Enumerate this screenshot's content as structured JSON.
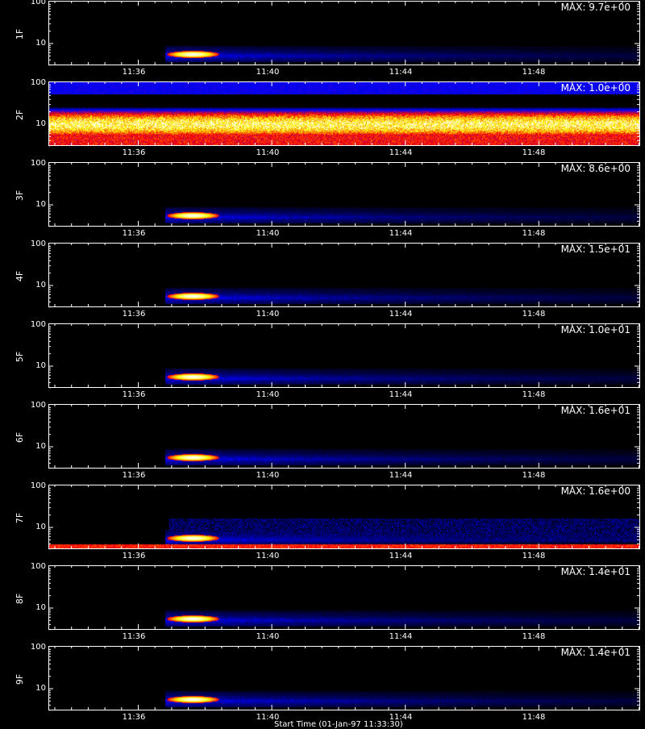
{
  "chart_data": {
    "type": "heatmap",
    "x_tick_labels": [
      "11:36",
      "11:40",
      "11:44",
      "11:48"
    ],
    "y_tick_labels": [
      "10",
      "100"
    ],
    "y_scale": "log",
    "colormap": [
      "#000000",
      "#0000ff",
      "#ff0000",
      "#ffff00",
      "#ffffff"
    ],
    "panels": [
      {
        "label": "1F",
        "max_text": "MAX: 9.7e+00",
        "pattern": "burst"
      },
      {
        "label": "2F",
        "max_text": "MAX: 1.0e+00",
        "pattern": "noise_band"
      },
      {
        "label": "3F",
        "max_text": "MAX: 8.6e+00",
        "pattern": "burst"
      },
      {
        "label": "4F",
        "max_text": "MAX: 1.5e+01",
        "pattern": "burst"
      },
      {
        "label": "5F",
        "max_text": "MAX: 1.0e+01",
        "pattern": "burst"
      },
      {
        "label": "6F",
        "max_text": "MAX: 1.6e+01",
        "pattern": "burst"
      },
      {
        "label": "7F",
        "max_text": "MAX: 1.6e+00",
        "pattern": "burst_noisy"
      },
      {
        "label": "8F",
        "max_text": "MAX: 1.4e+01",
        "pattern": "burst"
      },
      {
        "label": "9F",
        "max_text": "MAX: 1.4e+01",
        "pattern": "burst"
      }
    ]
  },
  "footer_text": "Start Time (01-Jan-97 11:33:30)"
}
